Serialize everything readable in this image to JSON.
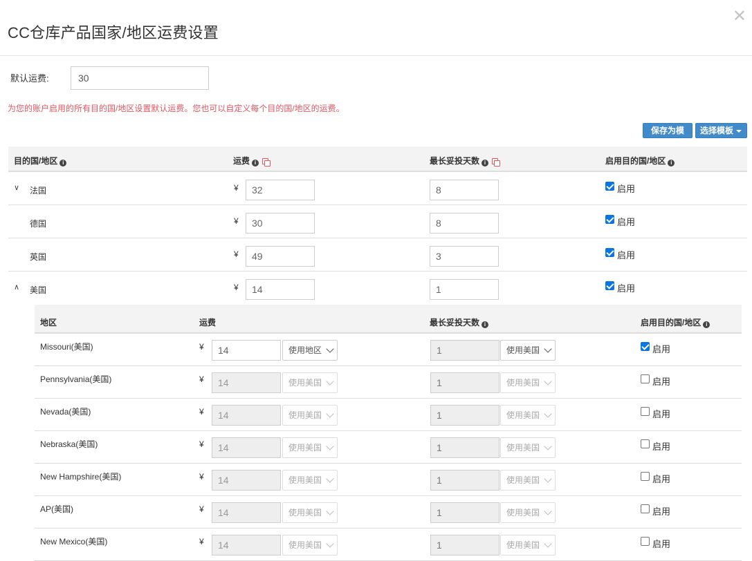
{
  "modal": {
    "title": "CC仓库产品国家/地区运费设置",
    "close_glyph": "✕"
  },
  "default_fee": {
    "label": "默认运费:",
    "value": "30"
  },
  "notice": "为您的账户启用的所有目的国/地区设置默认运费。您也可以自定义每个目的国/地区的运费。",
  "toolbar": {
    "save_template": "保存为模板",
    "select_template": "选择模板"
  },
  "table": {
    "headers": {
      "destination": "目的国/地区",
      "fee": "运费",
      "max_days": "最长妥投天数",
      "enable": "启用目的国/地区"
    },
    "currency": "¥",
    "enable_label": "启用",
    "rows": [
      {
        "chevron": "∨",
        "name": "法国",
        "fee": "32",
        "days": "8",
        "enabled": true
      },
      {
        "chevron": "",
        "name": "德国",
        "fee": "30",
        "days": "8",
        "enabled": true
      },
      {
        "chevron": "",
        "name": "英国",
        "fee": "49",
        "days": "3",
        "enabled": true
      },
      {
        "chevron": "∧",
        "name": "美国",
        "fee": "14",
        "days": "1",
        "enabled": true
      }
    ]
  },
  "subtable": {
    "headers": {
      "region": "地区",
      "fee": "运费",
      "max_days": "最长妥投天数",
      "enable": "启用目的国/地区"
    },
    "rows": [
      {
        "name": "Missouri(美国)",
        "fee": "14",
        "fee_source": "使用地区",
        "days": "1",
        "days_source": "使用美国",
        "enabled": true
      },
      {
        "name": "Pennsylvania(美国)",
        "fee": "14",
        "fee_source": "使用美国",
        "days": "1",
        "days_source": "使用美国",
        "enabled": false
      },
      {
        "name": "Nevada(美国)",
        "fee": "14",
        "fee_source": "使用美国",
        "days": "1",
        "days_source": "使用美国",
        "enabled": false
      },
      {
        "name": "Nebraska(美国)",
        "fee": "14",
        "fee_source": "使用美国",
        "days": "1",
        "days_source": "使用美国",
        "enabled": false
      },
      {
        "name": "New Hampshire(美国)",
        "fee": "14",
        "fee_source": "使用美国",
        "days": "1",
        "days_source": "使用美国",
        "enabled": false
      },
      {
        "name": "AP(美国)",
        "fee": "14",
        "fee_source": "使用美国",
        "days": "1",
        "days_source": "使用美国",
        "enabled": false
      },
      {
        "name": "New Mexico(美国)",
        "fee": "14",
        "fee_source": "使用美国",
        "days": "1",
        "days_source": "使用美国",
        "enabled": false
      }
    ]
  }
}
